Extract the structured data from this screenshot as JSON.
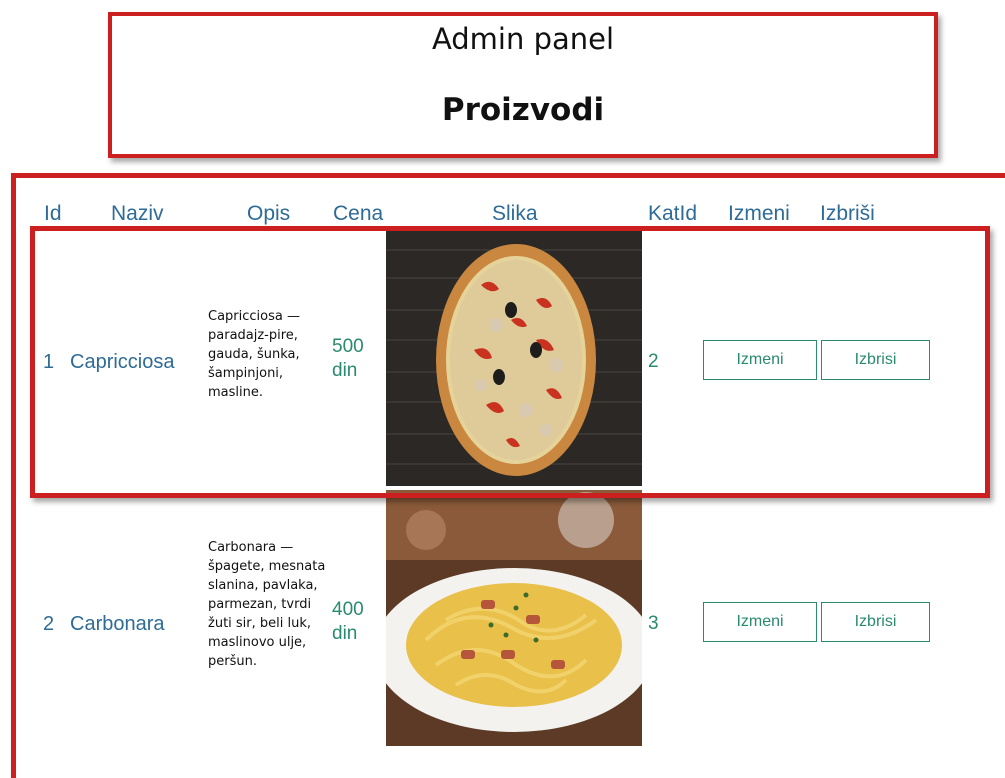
{
  "header": {
    "title": "Admin panel",
    "subtitle": "Proizvodi"
  },
  "table": {
    "columns": [
      "Id",
      "Naziv",
      "Opis",
      "Cena",
      "Slika",
      "KatId",
      "Izmeni",
      "Izbriši"
    ],
    "rows": [
      {
        "id": "1",
        "name": "Capricciosa",
        "description": "Capricciosa — paradajz-pire, gauda, šunka, šampinjoni, masline.",
        "price": "500 din",
        "image": "pizza-capricciosa-image",
        "cat_id": "2",
        "edit_label": "Izmeni",
        "delete_label": "Izbrisi"
      },
      {
        "id": "2",
        "name": "Carbonara",
        "description": "Carbonara — špagete, mesnata slanina, pavlaka, parmezan, tvrdi žuti sir, beli luk, maslinovo ulje, peršun.",
        "price": "400 din",
        "image": "pasta-carbonara-image",
        "cat_id": "3",
        "edit_label": "Izmeni",
        "delete_label": "Izbrisi"
      }
    ]
  },
  "colors": {
    "annotation_red": "#cc1f1f",
    "header_blue": "#2e6b96",
    "accent_green": "#2a8a6e"
  }
}
